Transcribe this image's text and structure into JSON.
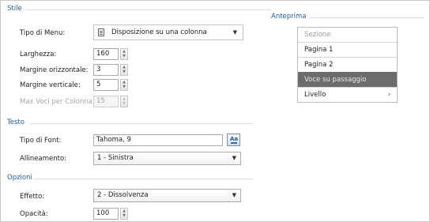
{
  "groups": {
    "stile": "Stile",
    "anteprima": "Anteprima",
    "testo": "Testo",
    "opzioni": "Opzioni"
  },
  "stile": {
    "tipo_menu_label": "Tipo di Menu:",
    "tipo_menu_value": "Disposizione su una colonna",
    "larghezza_label": "Larghezza:",
    "larghezza_value": "160",
    "margine_orizzontale_label": "Margine orizzontale:",
    "margine_orizzontale_value": "3",
    "margine_verticale_label": "Margine verticale:",
    "margine_verticale_value": "5",
    "max_voci_label": "Max Voci per Colonna:",
    "max_voci_value": "15"
  },
  "testo": {
    "tipo_font_label": "Tipo di Font:",
    "tipo_font_value": "Tahoma, 9",
    "allineamento_label": "Allineamento:",
    "allineamento_value": "1 - Sinistra"
  },
  "opzioni": {
    "effetto_label": "Effetto:",
    "effetto_value": "2 - Dissolvenza",
    "opacita_label": "Opacità:",
    "opacita_value": "100"
  },
  "preview": {
    "items": [
      {
        "label": "Sezione"
      },
      {
        "label": "Pagina 1"
      },
      {
        "label": "Pagina 2"
      },
      {
        "label": "Voce su passaggio"
      },
      {
        "label": "Livello",
        "chevron": "›"
      }
    ]
  },
  "glyphs": {
    "spin_up": "▲",
    "spin_down": "▼",
    "dropdown": "▼",
    "font_button": "Aa"
  },
  "colors": {
    "group_title": "#1f5ea8",
    "hover_item_bg": "#6c6c6c",
    "disabled_text": "#a6a6a6"
  }
}
